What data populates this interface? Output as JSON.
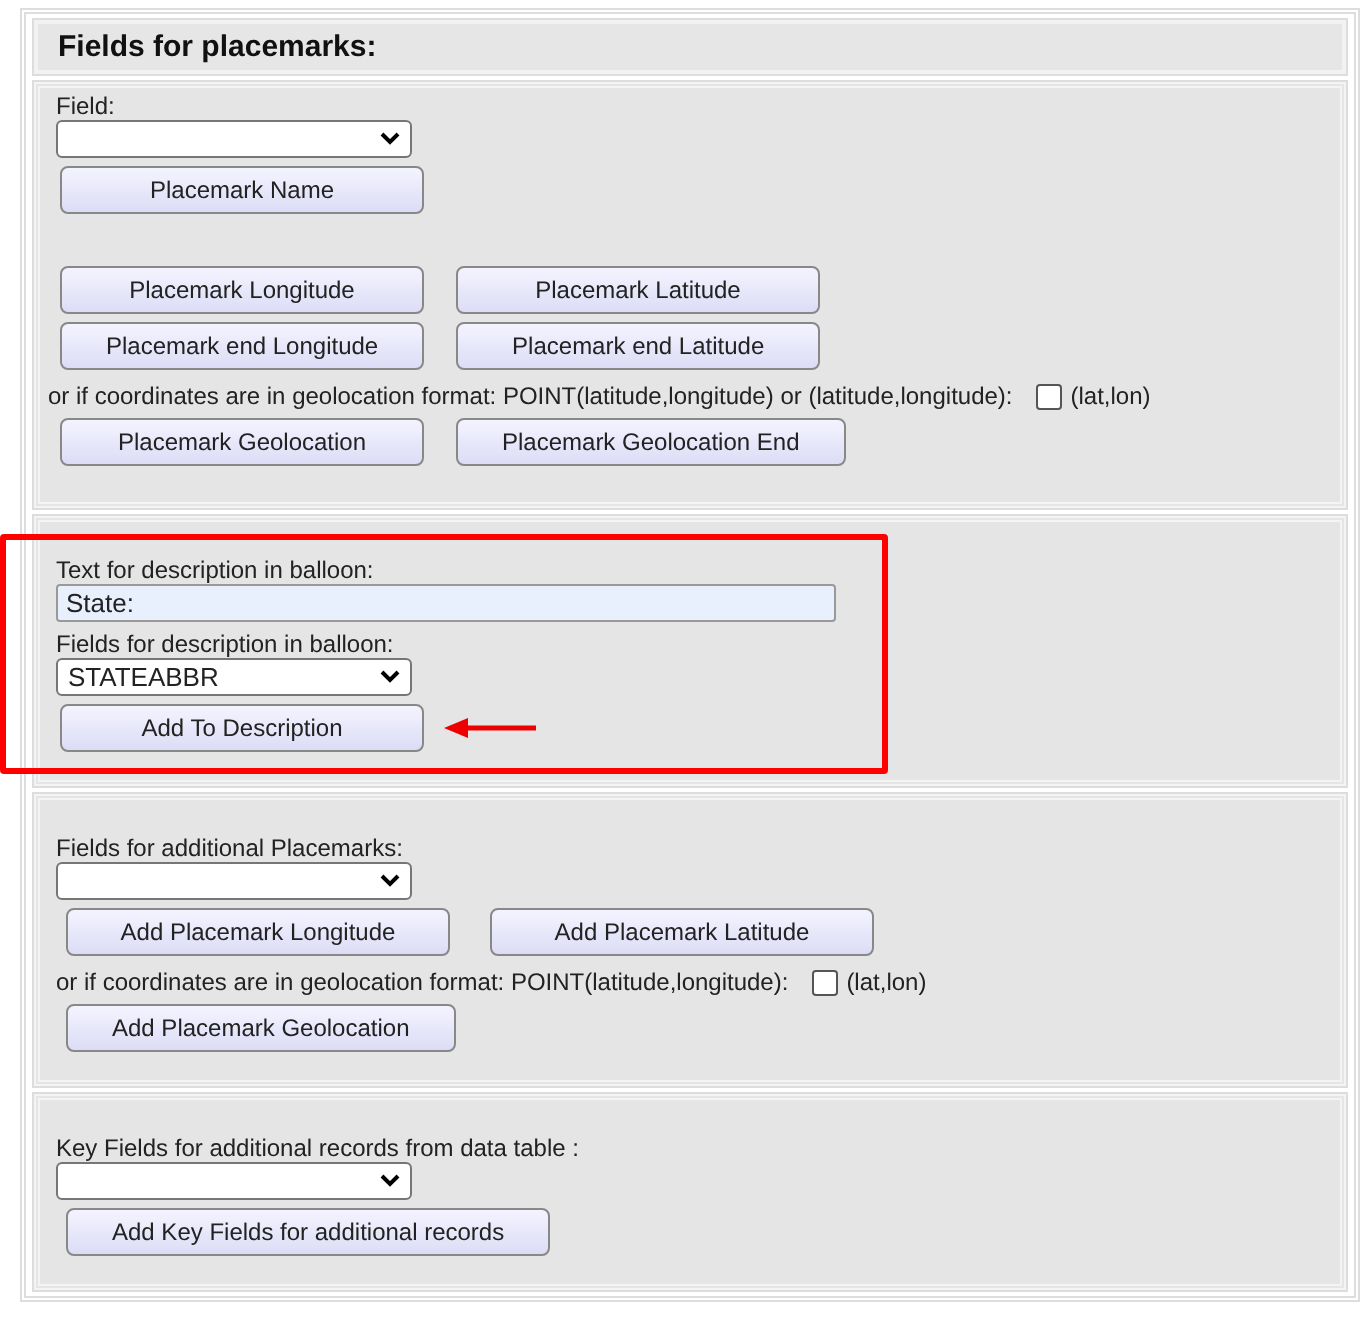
{
  "title": "Fields for placemarks:",
  "sections": [
    {
      "highlighted": false,
      "rows": [
        {
          "kind": "label",
          "text": "Field:"
        },
        {
          "kind": "select",
          "value": ""
        },
        {
          "kind": "buttons",
          "buttons": [
            "Placemark Name"
          ]
        },
        {
          "kind": "spacer"
        },
        {
          "kind": "buttons",
          "buttons": [
            "Placemark Longitude",
            "Placemark Latitude"
          ]
        },
        {
          "kind": "buttons",
          "buttons": [
            "Placemark end Longitude",
            "Placemark end Latitude"
          ]
        },
        {
          "kind": "checkbox",
          "text": "or if coordinates are in geolocation format: POINT(latitude,longitude) or (latitude,longitude):",
          "checked": false,
          "option": "(lat,lon)"
        },
        {
          "kind": "buttons",
          "buttons": [
            "Placemark Geolocation",
            "Placemark Geolocation End"
          ]
        }
      ]
    },
    {
      "highlighted": true,
      "rows": [
        {
          "kind": "label",
          "text": "Text for description in balloon:"
        },
        {
          "kind": "input",
          "value": "State:"
        },
        {
          "kind": "label",
          "text": "Fields for description in balloon:"
        },
        {
          "kind": "select",
          "value": "STATEABBR"
        },
        {
          "kind": "buttons",
          "buttons": [
            "Add To Description"
          ]
        }
      ]
    },
    {
      "highlighted": false,
      "rows": [
        {
          "kind": "label",
          "text": "Fields for additional Placemarks:"
        },
        {
          "kind": "select",
          "value": ""
        },
        {
          "kind": "buttons",
          "buttons": [
            "Add Placemark Longitude",
            "Add Placemark Latitude"
          ]
        },
        {
          "kind": "checkbox",
          "text": "or if coordinates are in geolocation format: POINT(latitude,longitude):",
          "checked": false,
          "option": "(lat,lon)"
        },
        {
          "kind": "buttons",
          "buttons": [
            "Add Placemark Geolocation"
          ]
        }
      ]
    },
    {
      "highlighted": false,
      "rows": [
        {
          "kind": "label",
          "text": "Key Fields for additional records from data table :"
        },
        {
          "kind": "select",
          "value": ""
        },
        {
          "kind": "buttons",
          "buttons": [
            "Add Key Fields for additional records"
          ]
        }
      ]
    }
  ]
}
